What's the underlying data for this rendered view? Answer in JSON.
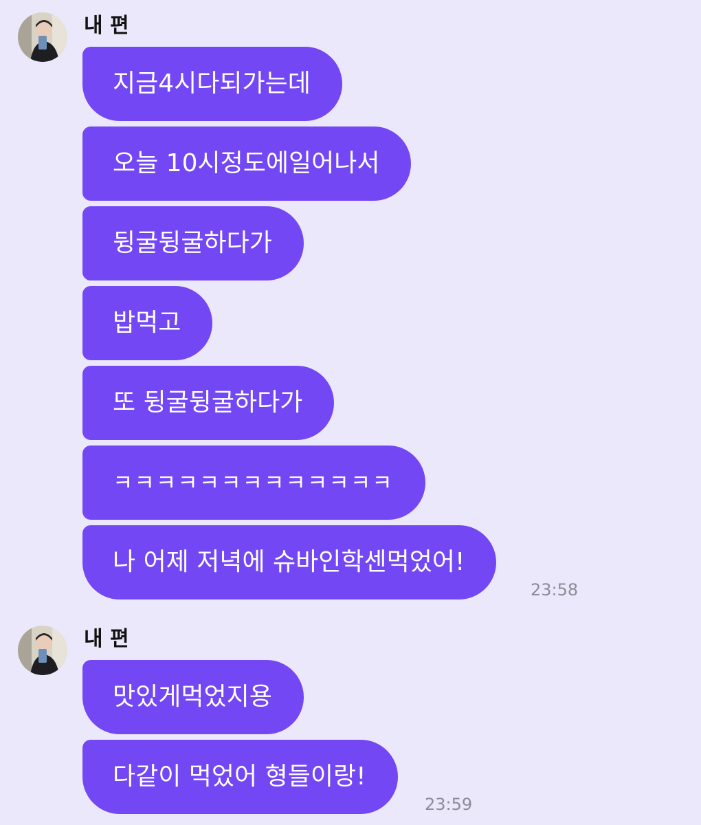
{
  "chat": {
    "groups": [
      {
        "sender": "내 편",
        "messages": [
          "지금4시다되가는데",
          "오늘 10시정도에일어나서",
          "뒹굴뒹굴하다가",
          "밥먹고",
          "또 뒹굴뒹굴하다가",
          "ㅋㅋㅋㅋㅋㅋㅋㅋㅋㅋㅋㅋㅋ",
          "나 어제 저녁에 슈바인학센먹었어!"
        ],
        "time": "23:58"
      },
      {
        "sender": "내 편",
        "messages": [
          "맛있게먹었지용",
          "다같이 먹었어 형들이랑!"
        ],
        "time": "23:59"
      }
    ]
  },
  "colors": {
    "background": "#ece8fb",
    "bubble": "#7347f4",
    "bubble_text": "#ffffff",
    "timestamp": "#8d8a98"
  }
}
